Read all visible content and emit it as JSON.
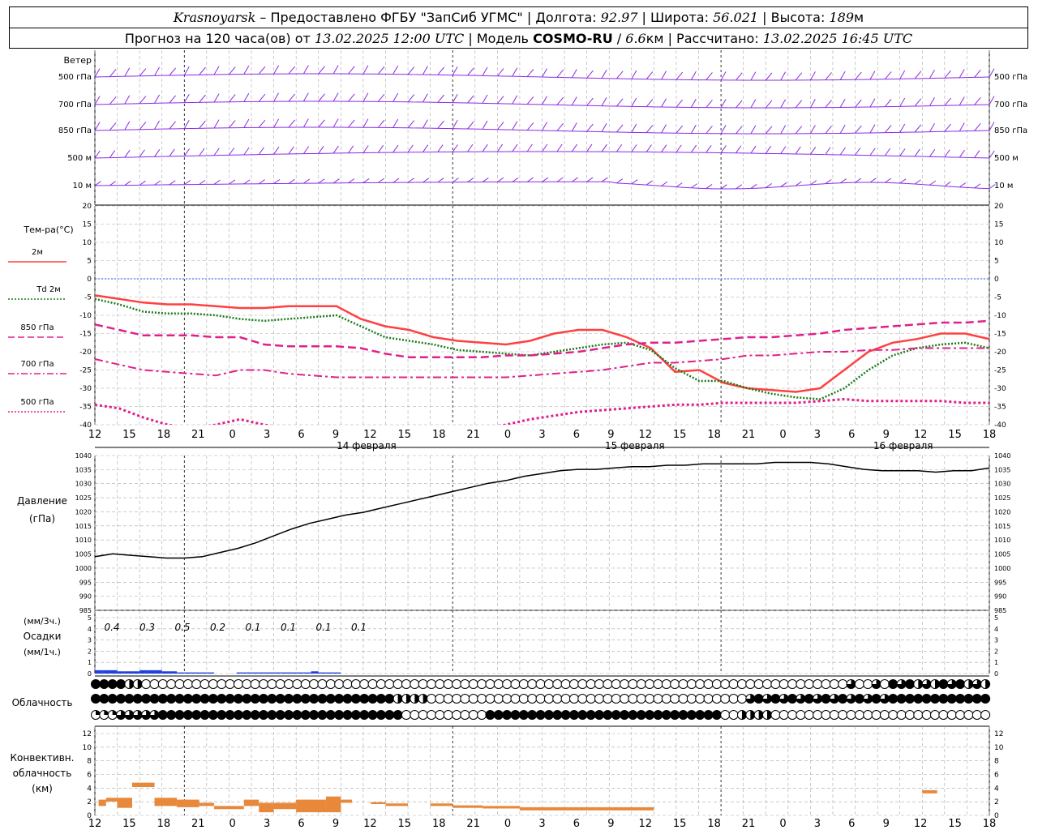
{
  "header": {
    "station": "Krasnoyarsk",
    "provider": "Предоставлено ФГБУ \"ЗапСиб УГМС\"",
    "lon_label": "Долгота:",
    "lon_value": "92.97",
    "lat_label": "Широта:",
    "lat_value": "56.021",
    "alt_label": "Высота:",
    "alt_value": "189",
    "alt_unit": "м",
    "forecast_prefix": "Прогноз на 120 часа(ов) от",
    "forecast_time": "13.02.2025 12:00 UTC",
    "model_label": "Модель",
    "model_name": "COSMO-RU",
    "model_res": "6.6",
    "model_res_unit": "км",
    "calc_label": "Рассчитано:",
    "calc_time": "13.02.2025 16:45 UTC"
  },
  "time_axis": {
    "hour_labels": [
      "12",
      "15",
      "18",
      "21",
      "0",
      "3",
      "6",
      "9",
      "12",
      "15",
      "18",
      "21",
      "0",
      "3",
      "6",
      "9",
      "12",
      "15",
      "18",
      "21",
      "0",
      "3",
      "6",
      "9",
      "12",
      "15",
      "18"
    ],
    "dates": [
      "14 февраля",
      "15 февраля",
      "16 февраля"
    ]
  },
  "wind_panel": {
    "title": "Ветер",
    "levels": [
      "500 гПа",
      "700 гПа",
      "850 гПа",
      "500 м",
      "10 м"
    ],
    "color": "#8a2be2"
  },
  "temp_panel": {
    "title": "Тем-ра(°C)",
    "legend": [
      {
        "label": "2м",
        "color": "#ff4040",
        "style": "solid"
      },
      {
        "label": "Td 2м",
        "color": "#1a7a1a",
        "style": "dotted"
      },
      {
        "label": "850 гПа",
        "color": "#e0208a",
        "style": "dashed"
      },
      {
        "label": "700 гПа",
        "color": "#e0208a",
        "style": "dashdot"
      },
      {
        "label": "500 гПа",
        "color": "#e0208a",
        "style": "dotted"
      }
    ],
    "y_ticks": [
      "20",
      "15",
      "10",
      "5",
      "0",
      "-5",
      "-10",
      "-15",
      "-20",
      "-25",
      "-30",
      "-35",
      "-40"
    ]
  },
  "pressure_panel": {
    "title": "Давление",
    "unit": "(гПа)",
    "y_ticks": [
      "1040",
      "1035",
      "1030",
      "1025",
      "1020",
      "1015",
      "1010",
      "1005",
      "1000",
      "995",
      "990",
      "985"
    ]
  },
  "precip_panel": {
    "unit_top": "(мм/3ч.)",
    "title": "Осадки",
    "unit_bottom": "(мм/1ч.)",
    "y_ticks": [
      "5",
      "4",
      "3",
      "2",
      "1",
      "0"
    ],
    "labels3h": [
      "0.4",
      "0.3",
      "0.5",
      "0.2",
      "0.1",
      "0.1",
      "0.1",
      "0.1"
    ]
  },
  "cloud_panel": {
    "title": "Облачность"
  },
  "conv_panel": {
    "title1": "Конвективн.",
    "title2": "облачность",
    "unit": "(км)",
    "y_ticks": [
      "12",
      "10",
      "8",
      "6",
      "4",
      "2",
      "0"
    ]
  },
  "chart_data": [
    {
      "type": "line",
      "name": "temperature",
      "x_hours": [
        0,
        3,
        6,
        9,
        12,
        15,
        18,
        21,
        24,
        27,
        30,
        33,
        36,
        39,
        42,
        45,
        48,
        51,
        54,
        57,
        60,
        63,
        66,
        69,
        72,
        75,
        78,
        81,
        84,
        87,
        90,
        93,
        96,
        99,
        102,
        105,
        108,
        111,
        114,
        117,
        120
      ],
      "ylim": [
        -40,
        20
      ],
      "series": [
        {
          "name": "2м",
          "values": [
            -4.5,
            -5.5,
            -6.5,
            -7,
            -7,
            -7.5,
            -8,
            -8,
            -7.5,
            -7.5,
            -7.5,
            -11,
            -13,
            -14,
            -16,
            -17,
            -17.5,
            -18,
            -17,
            -15,
            -14,
            -14,
            -16,
            -19,
            -25.5,
            -25,
            -28.5,
            -30,
            -30.5,
            -31,
            -30,
            -25,
            -20,
            -17.5,
            -16.5,
            -15,
            -15,
            -16.5
          ]
        },
        {
          "name": "Td 2м",
          "values": [
            -5.5,
            -7,
            -9,
            -9.5,
            -9.5,
            -10,
            -11,
            -11.5,
            -11,
            -10.5,
            -10,
            -13,
            -16,
            -17,
            -18,
            -19.5,
            -20,
            -20.5,
            -21,
            -20,
            -19,
            -18,
            -17.5,
            -19.5,
            -24.5,
            -28,
            -28,
            -30,
            -31.5,
            -32.5,
            -33,
            -30,
            -25,
            -21,
            -19,
            -18,
            -17.5,
            -19
          ]
        },
        {
          "name": "850 гПа",
          "values": [
            -12.5,
            -14,
            -15.5,
            -15.5,
            -15.5,
            -16,
            -16,
            -18,
            -18.5,
            -18.5,
            -18.5,
            -19,
            -20.5,
            -21.5,
            -21.5,
            -21.5,
            -21.5,
            -21,
            -21,
            -20.5,
            -20,
            -19,
            -18,
            -17.5,
            -17.5,
            -17,
            -16.5,
            -16,
            -16,
            -15.5,
            -15,
            -14,
            -13.5,
            -13,
            -12.5,
            -12,
            -12,
            -11.5
          ]
        },
        {
          "name": "700 гПа",
          "values": [
            -22,
            -23.5,
            -25,
            -25.5,
            -26,
            -26.5,
            -25,
            -25,
            -26,
            -26.5,
            -27,
            -27,
            -27,
            -27,
            -27,
            -27,
            -27,
            -27,
            -26.5,
            -26,
            -25.5,
            -25,
            -24,
            -23,
            -23,
            -22.5,
            -22,
            -21,
            -21,
            -20.5,
            -20,
            -20,
            -19.5,
            -19.5,
            -19,
            -19,
            -19,
            -19
          ]
        },
        {
          "name": "500 гПа",
          "values": [
            -34.5,
            -35.5,
            -38,
            -40,
            -41,
            -40,
            -38.5,
            -40,
            -41,
            -41,
            -41,
            -41,
            -41,
            -41,
            -41,
            -41,
            -41,
            -40,
            -38.5,
            -37.5,
            -36.5,
            -36,
            -35.5,
            -35,
            -34.5,
            -34.5,
            -34,
            -34,
            -34,
            -34,
            -33.5,
            -33,
            -33.5,
            -33.5,
            -33.5,
            -33.5,
            -34,
            -34
          ]
        }
      ]
    },
    {
      "type": "line",
      "name": "pressure",
      "ylim": [
        985,
        1040
      ],
      "x_hours": [
        0,
        3,
        6,
        9,
        12,
        15,
        18,
        21,
        24,
        27,
        30,
        33,
        36,
        39,
        42,
        45,
        48,
        51,
        54,
        57,
        60,
        63,
        66,
        69,
        72,
        75,
        78,
        81,
        84,
        87,
        90,
        93,
        96,
        99,
        102,
        105,
        108,
        111,
        114,
        117,
        120
      ],
      "values": [
        1003.5,
        1004.5,
        1004,
        1003.5,
        1003,
        1003,
        1003.5,
        1005,
        1006.5,
        1008.5,
        1011,
        1013.5,
        1015.5,
        1017,
        1018.5,
        1019.5,
        1021,
        1022.5,
        1024,
        1025.5,
        1027,
        1028.5,
        1030,
        1031,
        1032.5,
        1033.5,
        1034.5,
        1035,
        1035,
        1035.5,
        1036,
        1036,
        1036.5,
        1036.5,
        1037,
        1037,
        1037,
        1037,
        1037.5,
        1037.5,
        1037.5,
        1037,
        1036,
        1035,
        1034.5,
        1034.5,
        1034.5,
        1034,
        1034.5,
        1034.5,
        1035.5
      ]
    },
    {
      "type": "bar",
      "name": "precipitation_1h",
      "x_hours": [
        1,
        2,
        3,
        4,
        5,
        6,
        7,
        8,
        9,
        10,
        11,
        12,
        13,
        14,
        15,
        16,
        17,
        18,
        19,
        20,
        21,
        22,
        23,
        24,
        25,
        26,
        27,
        28,
        29,
        30,
        31,
        32,
        33
      ],
      "values": [
        0.3,
        0.3,
        0.3,
        0.2,
        0.2,
        0.2,
        0.3,
        0.3,
        0.3,
        0.2,
        0.2,
        0.1,
        0.1,
        0.1,
        0.1,
        0.1,
        0,
        0,
        0,
        0.1,
        0.1,
        0.1,
        0.1,
        0.1,
        0.1,
        0.1,
        0.1,
        0.1,
        0.1,
        0.2,
        0.1,
        0.1,
        0.1
      ]
    },
    {
      "type": "bar",
      "name": "convective_cloud",
      "ylim": [
        0,
        13
      ],
      "segments": [
        {
          "h0": 0.5,
          "h1": 1.5,
          "y0": 1.5,
          "y1": 2.5
        },
        {
          "h0": 1.5,
          "h1": 3.0,
          "y0": 2.2,
          "y1": 2.8
        },
        {
          "h0": 3.0,
          "h1": 5.0,
          "y0": 1.2,
          "y1": 2.8
        },
        {
          "h0": 5.0,
          "h1": 8.0,
          "y0": 4.5,
          "y1": 5.2
        },
        {
          "h0": 8.0,
          "h1": 11.0,
          "y0": 1.5,
          "y1": 2.8
        },
        {
          "h0": 11.0,
          "h1": 14.0,
          "y0": 1.3,
          "y1": 2.5
        },
        {
          "h0": 14.0,
          "h1": 16.0,
          "y0": 1.5,
          "y1": 2.0
        },
        {
          "h0": 16.0,
          "h1": 18.0,
          "y0": 1.0,
          "y1": 1.5
        },
        {
          "h0": 18.0,
          "h1": 20.0,
          "y0": 1.0,
          "y1": 1.5
        },
        {
          "h0": 20.0,
          "h1": 22.0,
          "y0": 1.5,
          "y1": 2.5
        },
        {
          "h0": 22.0,
          "h1": 24.0,
          "y0": 0.5,
          "y1": 2.0
        },
        {
          "h0": 24.0,
          "h1": 27.0,
          "y0": 1.0,
          "y1": 2.0
        },
        {
          "h0": 27.0,
          "h1": 31.0,
          "y0": 0.5,
          "y1": 2.5
        },
        {
          "h0": 31.0,
          "h1": 33.0,
          "y0": 0.5,
          "y1": 3.0
        },
        {
          "h0": 33.0,
          "h1": 34.5,
          "y0": 2.0,
          "y1": 2.5
        },
        {
          "h0": 37.0,
          "h1": 39.0,
          "y0": 1.8,
          "y1": 2.1
        },
        {
          "h0": 39.0,
          "h1": 42.0,
          "y0": 1.5,
          "y1": 1.9
        },
        {
          "h0": 45.0,
          "h1": 48.0,
          "y0": 1.5,
          "y1": 1.9
        },
        {
          "h0": 48.0,
          "h1": 52.0,
          "y0": 1.2,
          "y1": 1.6
        },
        {
          "h0": 52.0,
          "h1": 57.0,
          "y0": 1.1,
          "y1": 1.5
        },
        {
          "h0": 57.0,
          "h1": 65.0,
          "y0": 0.8,
          "y1": 1.3
        },
        {
          "h0": 65.0,
          "h1": 75.0,
          "y0": 0.8,
          "y1": 1.3
        },
        {
          "h0": 111.0,
          "h1": 113.0,
          "y0": 3.5,
          "y1": 4.0
        }
      ]
    }
  ]
}
